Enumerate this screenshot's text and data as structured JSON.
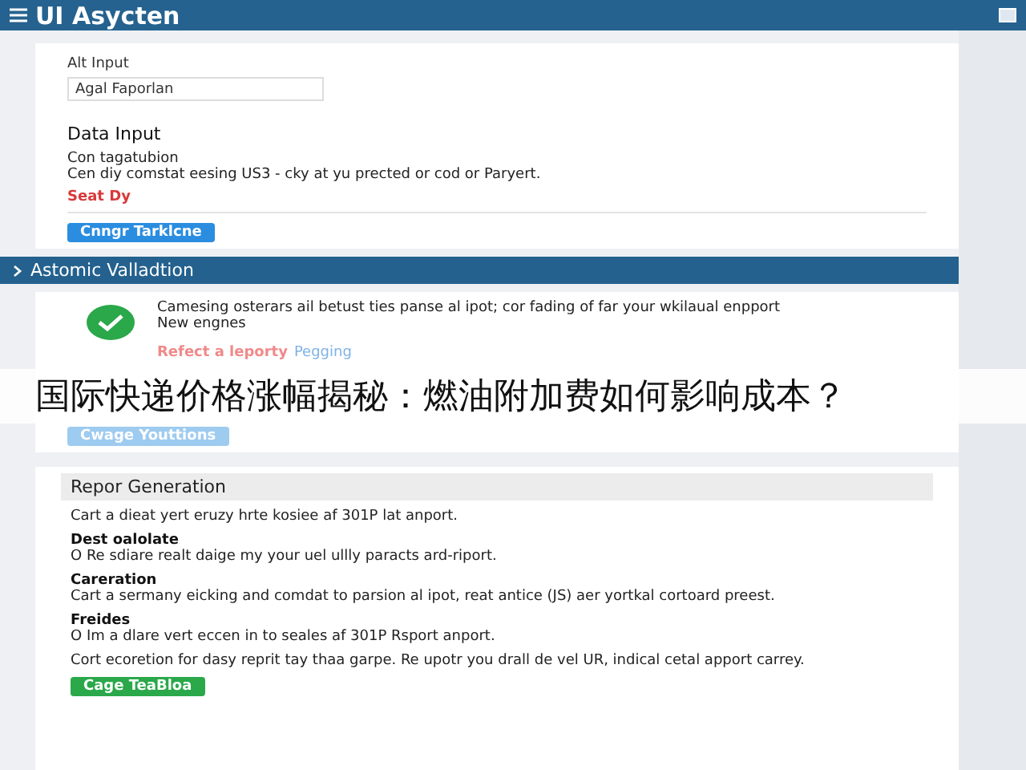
{
  "app_bar": {
    "title": "UI Asycten"
  },
  "input_card": {
    "field_label": "Alt Input",
    "field_value": "Agal Faporlan",
    "section_title": "Data Input",
    "item_title": "Con tagatubion",
    "item_text": "Cen diy comstat eesing US3 - cky at yu prected or cod or Paryert.",
    "error_text": "Seat Dy",
    "button": "Cnngr Tarklcne"
  },
  "validation": {
    "title": "Astomic Valladtion",
    "expanded": true,
    "status_line": "Camesing osterars ail betust ties panse al ipot; cor fading of far your wkilaual enpport",
    "status_sub": "New engnes",
    "alert": "Refect a leporty",
    "alert_link": "Pegging",
    "button": "Cwage Youttions"
  },
  "overlay_caption": "国际快递价格涨幅揭秘：燃油附加费如何影响成本？",
  "report": {
    "title": "Repor Generation",
    "blocks": [
      {
        "text": "Cart a dieat yert eruzy hrte kosiee af 301P lat anport."
      },
      {
        "heading": "Dest oalolate",
        "text": "O Re sdiare realt daige my your uel ullly paracts ard-riport."
      },
      {
        "heading": "Careration",
        "text": "Cart a sermany eicking and comdat to parsion al ipot, reat antice (JS) aer yortkal cortoard preest."
      },
      {
        "heading": "Freides",
        "text": "O Im a dlare vert eccen in to seales af 301P Rsport anport."
      },
      {
        "text": "Cort ecoretion for dasy reprit tay thaa garpe. Re upotr you drall de vel UR, indical cetal apport carrey."
      }
    ],
    "button": "Cage TeaBloa"
  }
}
